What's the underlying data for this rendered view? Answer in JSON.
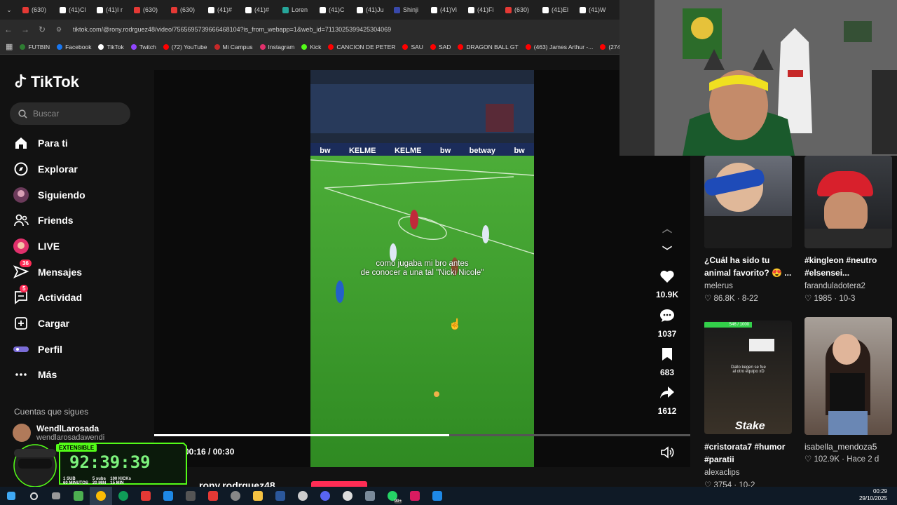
{
  "browser": {
    "tabs": [
      {
        "label": "(630)",
        "color": "#e53935"
      },
      {
        "label": "(41)Cl",
        "color": "#ffffff"
      },
      {
        "label": "(41)I r",
        "color": "#ffffff"
      },
      {
        "label": "(630)",
        "color": "#e53935"
      },
      {
        "label": "(630)",
        "color": "#e53935"
      },
      {
        "label": "(41)#",
        "color": "#ffffff"
      },
      {
        "label": "(41)#",
        "color": "#ffffff"
      },
      {
        "label": "Loren",
        "color": "#26a69a"
      },
      {
        "label": "(41)C",
        "color": "#ffffff"
      },
      {
        "label": "(41)Ju",
        "color": "#ffffff"
      },
      {
        "label": "Shinji",
        "color": "#3949ab"
      },
      {
        "label": "(41)Vi",
        "color": "#ffffff"
      },
      {
        "label": "(41)Fi",
        "color": "#ffffff"
      },
      {
        "label": "(630)",
        "color": "#e53935"
      },
      {
        "label": "(41)El",
        "color": "#ffffff"
      },
      {
        "label": "(41)W",
        "color": "#ffffff"
      }
    ],
    "url": "tiktok.com/@rony.rodrguez48/video/7565695739666468104?is_from_webapp=1&web_id=7113025399425304069",
    "bookmarks": [
      {
        "label": "FUTBIN",
        "color": "#2e7d32"
      },
      {
        "label": "Facebook",
        "color": "#1877f2"
      },
      {
        "label": "TikTok",
        "color": "#ffffff"
      },
      {
        "label": "Twitch",
        "color": "#9146ff"
      },
      {
        "label": "(72) YouTube",
        "color": "#ff0000"
      },
      {
        "label": "Mi Campus",
        "color": "#c62828"
      },
      {
        "label": "Instagram",
        "color": "#e1306c"
      },
      {
        "label": "Kick",
        "color": "#53fc18"
      },
      {
        "label": "CANCION DE PETER",
        "color": "#ff0000"
      },
      {
        "label": "SAU",
        "color": "#ff0000"
      },
      {
        "label": "SAD",
        "color": "#ff0000"
      },
      {
        "label": "DRAGON BALL GT",
        "color": "#ff0000"
      },
      {
        "label": "(463) James Arthur -...",
        "color": "#ff0000"
      },
      {
        "label": "(274",
        "color": "#ff0000"
      }
    ]
  },
  "sidebar": {
    "logo": "TikTok",
    "search_placeholder": "Buscar",
    "items": [
      {
        "label": "Para ti",
        "icon": "home-icon"
      },
      {
        "label": "Explorar",
        "icon": "compass-icon"
      },
      {
        "label": "Siguiendo",
        "icon": "following-avatar-icon"
      },
      {
        "label": "Friends",
        "icon": "friends-icon"
      },
      {
        "label": "LIVE",
        "icon": "live-avatar-icon"
      },
      {
        "label": "Mensajes",
        "icon": "message-icon",
        "badge": "36"
      },
      {
        "label": "Actividad",
        "icon": "activity-icon",
        "badge": "5"
      },
      {
        "label": "Cargar",
        "icon": "upload-icon"
      },
      {
        "label": "Perfil",
        "icon": "profile-icon"
      },
      {
        "label": "Más",
        "icon": "more-icon"
      }
    ],
    "following_title": "Cuentas que sigues",
    "following": [
      {
        "name": "WendlLarosada",
        "handle": "wendlarosadawendi"
      }
    ]
  },
  "video": {
    "caption_line1": "como jugaba mi bro antes",
    "caption_line2": "de conocer a una tal \"Nicki Nicole\"",
    "time": "00:16 / 00:30",
    "progress": 0.55,
    "author": "rony.rodrguez48",
    "ads": [
      "KELME",
      "KELME",
      "bw",
      "betway",
      "bw",
      "bw"
    ]
  },
  "actions": {
    "likes": "10.9K",
    "comments": "1037",
    "saves": "683",
    "shares": "1612"
  },
  "recommended": [
    {
      "title": "¿Cuál ha sido tu animal favorito? 😍 ...",
      "user": "melerus",
      "views": "86.8K",
      "date": "8-22"
    },
    {
      "title": "#kingleon #neutro #elsensei...",
      "user": "faranduladotera2",
      "views": "1985",
      "date": "10-3"
    },
    {
      "title": "#cristorata7 #humor #paratii",
      "user": "alexaclips",
      "views": "3754",
      "date": "10-2",
      "overlay_text": "Stake",
      "bar_text": "546 / 1000",
      "inner_caption": "Dallo kegen se fue al otro equipo xD"
    },
    {
      "title": "isabella_mendoza5",
      "user": "",
      "views": "102.9K",
      "date": "Hace 2 d"
    }
  ],
  "stream_overlay": {
    "label": "EXTENSIBLE",
    "timer": "92:39:39",
    "rewards": [
      "1 SUB",
      "60 MINUTOS",
      "5 subs",
      "20 MIN",
      "100 KICKs",
      "15 MIN"
    ]
  },
  "taskbar": {
    "time": "00:29",
    "date": "29/10/2025",
    "badge": "99+"
  }
}
